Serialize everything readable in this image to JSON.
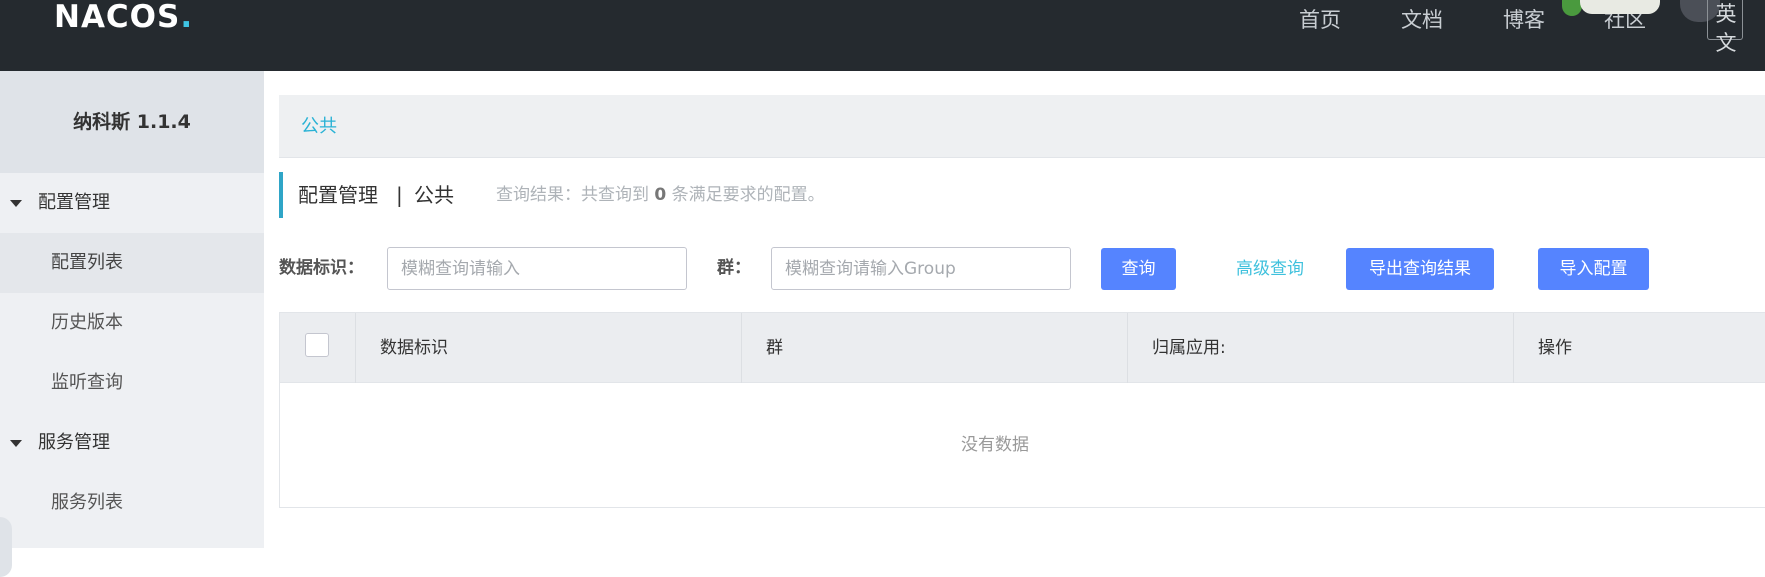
{
  "header": {
    "logo": "NACOS",
    "logo_dot": ".",
    "nav": [
      "首页",
      "文档",
      "博客",
      "社区"
    ],
    "lang_button": "英文"
  },
  "sidebar": {
    "title": "纳科斯 1.1.4",
    "groups": [
      {
        "label": "配置管理",
        "items": [
          "配置列表",
          "历史版本",
          "监听查询"
        ]
      },
      {
        "label": "服务管理",
        "items": [
          "服务列表"
        ]
      }
    ],
    "active_item": "配置列表"
  },
  "breadcrumb": {
    "namespace_link": "公共"
  },
  "title": {
    "main": "配置管理",
    "separator": "|",
    "namespace": "公共",
    "result_prefix": "查询结果：共查询到",
    "result_count": "0",
    "result_suffix": "条满足要求的配置。"
  },
  "filters": {
    "data_id_label": "数据标识：",
    "data_id_placeholder": "模糊查询请输入",
    "data_id_value": "",
    "group_label": "群：",
    "group_placeholder": "模糊查询请输入Group",
    "group_value": "",
    "query_button": "查询",
    "advanced_query": "高级查询",
    "export_button": "导出查询结果",
    "import_button": "导入配置"
  },
  "table": {
    "columns": [
      "数据标识",
      "群",
      "归属应用:",
      "操作"
    ],
    "rows": [],
    "empty_text": "没有数据"
  },
  "colors": {
    "header_bg": "#252a2f",
    "primary_button": "#5584ff",
    "link": "#29b2d5",
    "sidebar_bg": "#eef0f3"
  }
}
